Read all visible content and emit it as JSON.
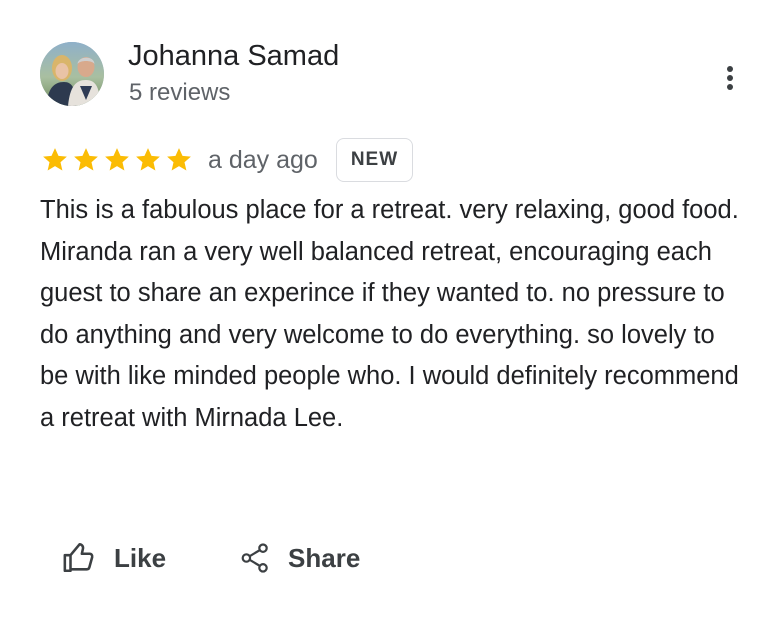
{
  "author": {
    "name": "Johanna Samad",
    "meta": "5 reviews",
    "avatar_icon": "profile-photo"
  },
  "review": {
    "rating": 5,
    "rating_max": 5,
    "star_color": "#fbbc04",
    "time_ago": "a day ago",
    "badge": "NEW",
    "text": "This is a fabulous place for a retreat. very relaxing, good food. Miranda ran a very well balanced retreat, encouraging each guest to share an experince if they wanted to. no pressure to do anything and very welcome to do everything. so lovely to be with like minded people who. I would definitely recommend a retreat with Mirnada Lee."
  },
  "actions": {
    "like_label": "Like",
    "like_icon": "thumbs-up-icon",
    "share_label": "Share",
    "share_icon": "share-icon",
    "more_icon": "more-vert-icon"
  }
}
